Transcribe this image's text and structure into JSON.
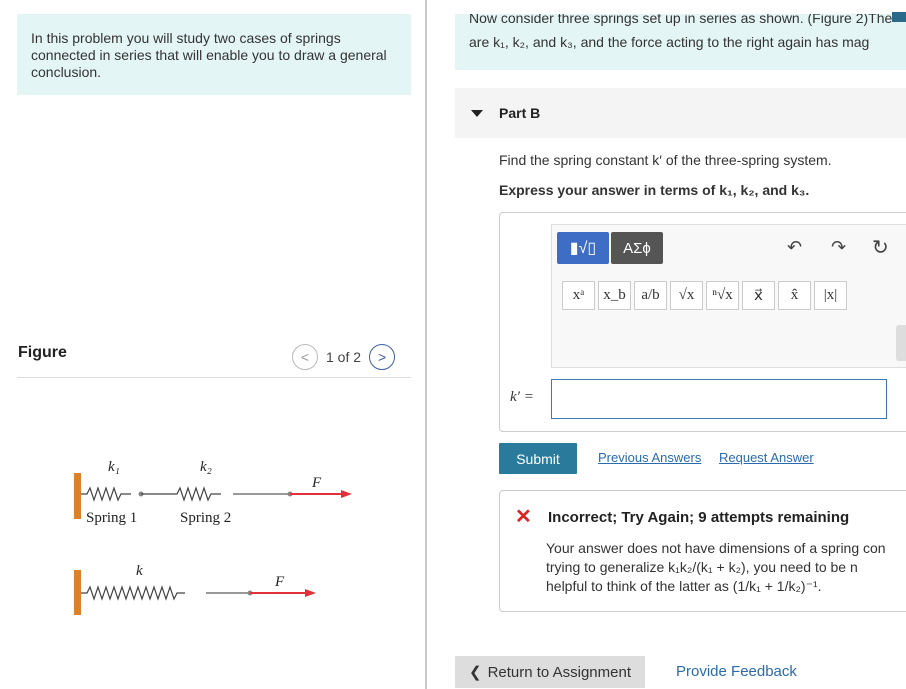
{
  "intro": {
    "text": "In this problem you will study two cases of springs connected in series that will enable you to draw a general conclusion."
  },
  "figure": {
    "label": "Figure",
    "pager": "1 of 2",
    "prev_glyph": "<",
    "next_glyph": ">",
    "spring1": {
      "k_label": "k₁",
      "name": "Spring 1"
    },
    "spring2": {
      "k_label": "k₂",
      "name": "Spring 2"
    },
    "single": {
      "k_label": "k"
    },
    "force_label": "F⃗"
  },
  "context": {
    "line1": "Now consider three springs set up in series as shown. (Figure 2)The",
    "line2": "are k₁, k₂, and k₃, and the force acting to the right again has mag"
  },
  "part": {
    "title": "Part B"
  },
  "question": "Find the spring constant k′ of the three-spring system.",
  "instruction": "Express your answer in terms of k₁, k₂, and k₃.",
  "toolbar": {
    "template_label": "▮√▯",
    "greek_label": "ΑΣϕ",
    "undo": "↶",
    "redo": "↷",
    "reset": "↻",
    "palette": [
      "xᵃ",
      "x_b",
      "a/b",
      "√x",
      "ⁿ√x",
      "x⃗",
      "x̂",
      "|x|"
    ]
  },
  "answer": {
    "label": "k′ =",
    "value": ""
  },
  "actions": {
    "submit": "Submit",
    "previous_answers": "Previous Answers",
    "request_answer": "Request Answer"
  },
  "feedback": {
    "title": "Incorrect; Try Again; 9 attempts remaining",
    "line1": "Your answer does not have dimensions of a spring con",
    "line2": "trying to generalize k₁k₂/(k₁ + k₂), you need to be n",
    "line3": "helpful to think of the latter as (1/k₁ + 1/k₂)⁻¹."
  },
  "footer": {
    "return": "Return to Assignment",
    "provide_feedback": "Provide Feedback"
  },
  "colors": {
    "accent": "#2a7a9c",
    "link": "#2a6bb0",
    "force_arrow": "#e0303a",
    "intro_bg": "#e4f5f5",
    "error": "#dd2222"
  }
}
